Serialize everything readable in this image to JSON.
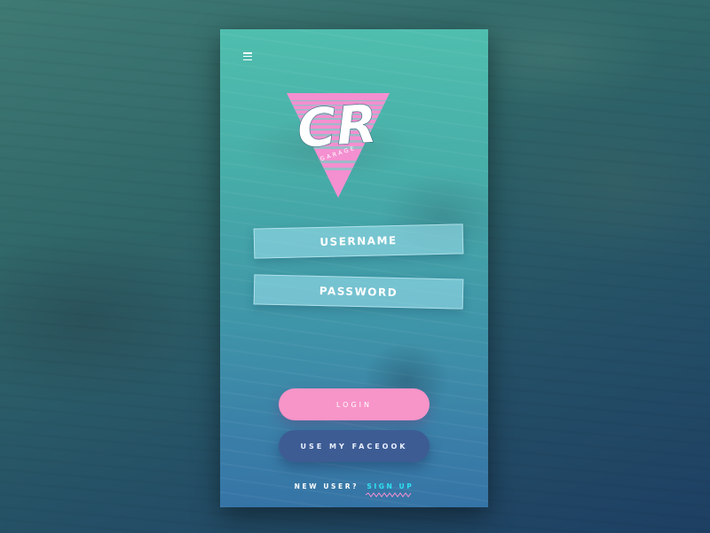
{
  "logo": {
    "monogram": "CR",
    "sub_text": "GARAGE",
    "triangle_color": "#f48fd0",
    "letter_color": "#ffffff"
  },
  "menu": {
    "icon": "hamburger-menu-icon"
  },
  "form": {
    "username_placeholder": "USERNAME",
    "password_placeholder": "PASSWORD"
  },
  "buttons": {
    "login_label": "LOGIN",
    "facebook_label": "USE MY FACEOOK"
  },
  "footer": {
    "prompt": "NEW USER?",
    "signup_label": "SIGN UP",
    "signup_color": "#2ee2f2"
  },
  "colors": {
    "login_button": "#f794c8",
    "facebook_button": "#3d5c94",
    "field_fill": "#a0e1f0"
  }
}
